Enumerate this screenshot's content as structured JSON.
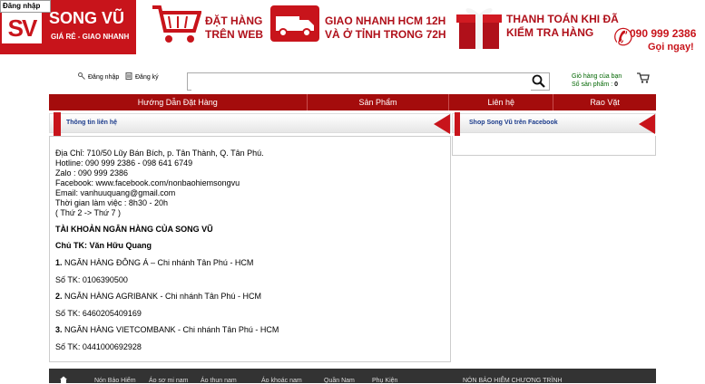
{
  "header": {
    "login_tag": "Đăng nhập",
    "logo_mark": "SV",
    "brand": "SONG VŨ",
    "tagline": "GIÁ RẺ - GIAO NHANH",
    "promo_order_line1": "ĐẶT HÀNG",
    "promo_order_line2": "TRÊN WEB",
    "promo_ship_line1": "GIAO NHANH HCM 12H",
    "promo_ship_line2": "VÀ Ở TỈNH TRONG 72H",
    "promo_pay_line1": "THANH TOÁN KHI ĐÃ",
    "promo_pay_line2": "KIỂM TRA HÀNG",
    "phone": "090 999 2386",
    "phone_cta": "Gọi ngay!",
    "accent": "#c8141b"
  },
  "utility": {
    "login": "Đăng nhập",
    "register": "Đăng ký",
    "search_value": "",
    "cart_label": "Giỏ hàng của bạn",
    "cart_count_label": "Số sản phẩm :",
    "cart_count": "0"
  },
  "nav": {
    "items": [
      "Hướng Dẫn Đặt Hàng",
      "Sản Phẩm",
      "Liên hệ",
      "Rao Vặt"
    ],
    "bg": "#a40c0c"
  },
  "panels": {
    "contact_title": "Thông tin liên hệ",
    "facebook_title": "Shop Song Vũ trên Facebook"
  },
  "contact": {
    "address": "Địa Chỉ: 710/50 Lũy Bán Bích, p. Tân Thành, Q. Tân Phú.",
    "hotline": "Hotline: 090 999 2386 - 098 641 6749",
    "zalo": "Zalo : 090 999 2386",
    "facebook": "Facebook: www.facebook.com/nonbaohiemsongvu",
    "email": "Email: vanhuuquang@gmail.com",
    "hours": "Thời gian làm việc : 8h30 - 20h",
    "days": "( Thứ 2 -> Thứ 7 )",
    "bank_heading": "TÀI KHOẢN NGÂN HÀNG CỦA SONG VŨ",
    "holder": "Chủ TK: Văn Hữu Quang",
    "banks": [
      {
        "num": "1.",
        "name": "NGÂN HÀNG ĐÔNG Á – Chi nhánh Tân Phú - HCM",
        "account": "Số TK: 0106390500"
      },
      {
        "num": "2.",
        "name": "NGÂN HÀNG AGRIBANK - Chi nhánh Tân Phú - HCM",
        "account": "Số TK: 6460205409169"
      },
      {
        "num": "3.",
        "name": "NGÂN HÀNG VIETCOMBANK - Chi nhánh Tân Phú - HCM",
        "account": "Số TK: 0441000692928"
      }
    ]
  },
  "footer": {
    "items": [
      "Nón Bảo Hiểm",
      "Áo sơ mi nam",
      "Áo thun nam",
      "Áo khoác nam",
      "Quần Nam",
      "Phụ Kiện",
      "NÓN BẢO HIỂM CHƯƠNG TRÌNH"
    ]
  }
}
